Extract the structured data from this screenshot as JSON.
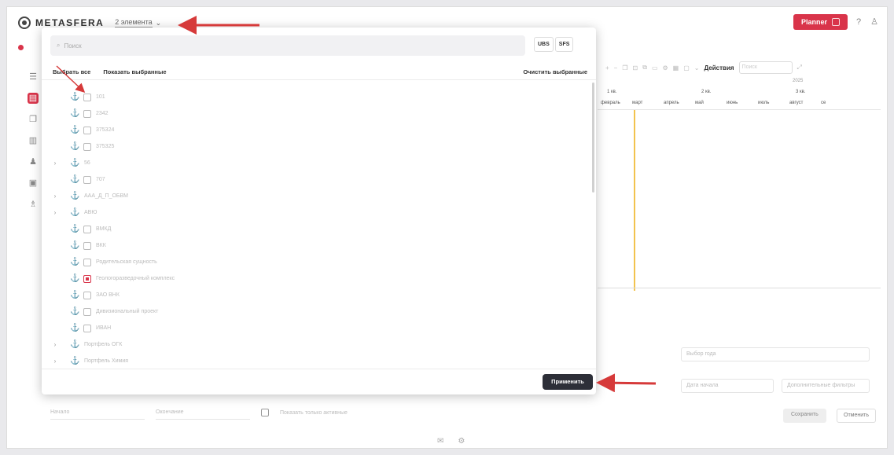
{
  "app": {
    "logo": "METASFERA",
    "selection_count": "2 элемента"
  },
  "header": {
    "plan_label": "Planner"
  },
  "modal": {
    "search_placeholder": "Поиск",
    "segments": [
      "UBS",
      "SFS"
    ],
    "select_all": "Выбрать все",
    "show_selected": "Показать выбранные",
    "clear_selected": "Очистить выбранные",
    "apply_label": "Применить",
    "tree": [
      {
        "label": "101",
        "has_checkbox": true,
        "checked": false,
        "expandable": false
      },
      {
        "label": "2342",
        "has_checkbox": true,
        "checked": false,
        "expandable": false
      },
      {
        "label": "375324",
        "has_checkbox": true,
        "checked": false,
        "expandable": false
      },
      {
        "label": "375325",
        "has_checkbox": true,
        "checked": false,
        "expandable": false
      },
      {
        "label": "56",
        "has_checkbox": false,
        "checked": false,
        "expandable": true
      },
      {
        "label": "707",
        "has_checkbox": true,
        "checked": false,
        "expandable": false
      },
      {
        "label": "ААА_Д_П_ОБВМ",
        "has_checkbox": false,
        "checked": false,
        "expandable": true
      },
      {
        "label": "АВЮ",
        "has_checkbox": false,
        "checked": false,
        "expandable": true
      },
      {
        "label": "ВМКД",
        "has_checkbox": true,
        "checked": false,
        "expandable": false
      },
      {
        "label": "ВКК",
        "has_checkbox": true,
        "checked": false,
        "expandable": false
      },
      {
        "label": "Родительская сущность",
        "has_checkbox": true,
        "checked": false,
        "expandable": false
      },
      {
        "label": "Геологоразведочный комплекс",
        "has_checkbox": true,
        "checked": true,
        "expandable": false
      },
      {
        "label": "ЗАО ВНК",
        "has_checkbox": true,
        "checked": false,
        "expandable": false
      },
      {
        "label": "Дивизиональный проект",
        "has_checkbox": true,
        "checked": false,
        "expandable": false
      },
      {
        "label": "ИВАН",
        "has_checkbox": true,
        "checked": false,
        "expandable": false
      },
      {
        "label": "Портфель ОГК",
        "has_checkbox": false,
        "checked": false,
        "expandable": true
      },
      {
        "label": "Портфель Химия",
        "has_checkbox": false,
        "checked": false,
        "expandable": true
      }
    ]
  },
  "background": {
    "actions_label": "Действия",
    "search_placeholder": "Поиск",
    "year": "2025",
    "quarters": [
      "1 кв.",
      "2 кв.",
      "3 кв."
    ],
    "months": [
      "февраль",
      "март",
      "апрель",
      "май",
      "июнь",
      "июль",
      "август",
      "се"
    ],
    "field_date_from": "Дата начала",
    "field_extra": "Дополнительные фильтры",
    "field_year": "Выбор года",
    "bottom_from": "Начало",
    "bottom_to": "Окончание",
    "bottom_checkbox_label": "Показать только активные",
    "save_label": "Сохранить",
    "cancel_label": "Отменить"
  },
  "colors": {
    "accent": "#d9344a",
    "apply_bg": "#2d2f38",
    "today_line": "#f2c34e",
    "annotation_arrow": "#d63a3a"
  }
}
